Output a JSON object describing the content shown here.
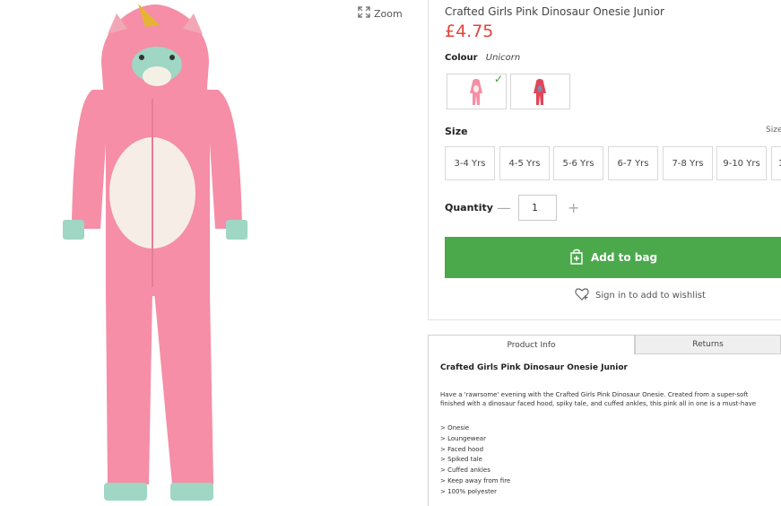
{
  "zoom_label": "Zoom",
  "product": {
    "title": "Crafted Girls Pink Dinosaur Onesie Junior",
    "price": "£4.75",
    "colour_label": "Colour",
    "colour_value": "Unicorn"
  },
  "size": {
    "label": "Size",
    "guide": "Size",
    "options": [
      "3-4 Yrs",
      "4-5 Yrs",
      "5-6 Yrs",
      "6-7 Yrs",
      "7-8 Yrs",
      "9-10 Yrs",
      "1"
    ]
  },
  "quantity": {
    "label": "Quantity",
    "minus": "—",
    "plus": "+",
    "value": "1"
  },
  "add_to_bag": "Add to bag",
  "wishlist": "Sign in to add to wishlist",
  "tabs": {
    "product_info": "Product Info",
    "returns": "Returns"
  },
  "info": {
    "title": "Crafted Girls Pink Dinosaur Onesie Junior",
    "desc_line1": "Have a 'rawrsome' evening with the Crafted Girls Pink Dinosaur Onesie. Created from a super-soft",
    "desc_line2": "finished with a dinosaur faced hood, spiky tale, and cuffed ankles, this pink all in one is a must-have",
    "bullets": [
      "> Onesie",
      "> Loungewear",
      "> Faced hood",
      "> Spiked tale",
      "> Cuffed ankles",
      "> Keep away from fire",
      "> 100% polyester"
    ]
  },
  "colors": {
    "price": "#e0453b",
    "add_to_bag_bg": "#4ba94b",
    "check": "#3c9c48",
    "onesie_pink": "#f58ea6"
  }
}
